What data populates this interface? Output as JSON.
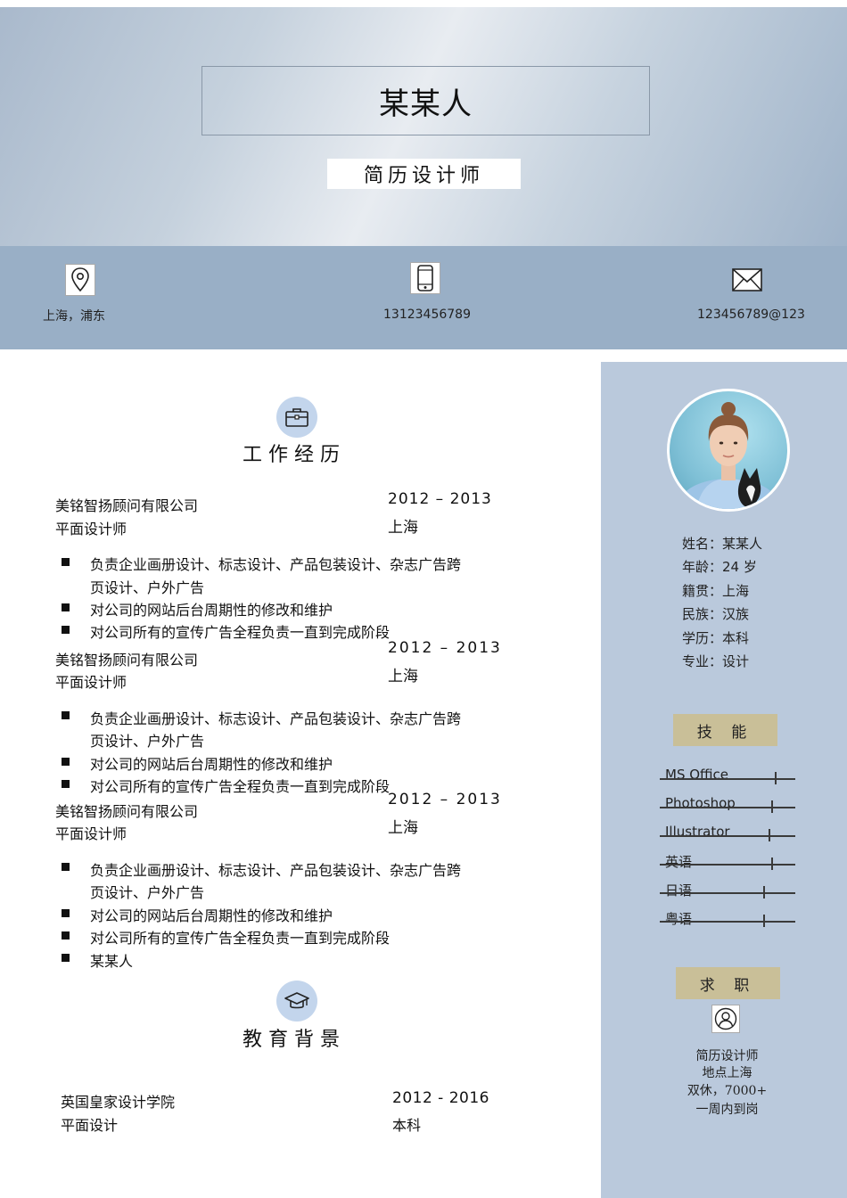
{
  "header": {
    "name": "某某人",
    "title": "简历设计师"
  },
  "contact": [
    {
      "icon": "location-pin-icon",
      "text": "上海，浦东"
    },
    {
      "icon": "mobile-phone-icon",
      "text": "13123456789"
    },
    {
      "icon": "envelope-icon",
      "text": "123456789@123"
    }
  ],
  "work": {
    "title": "工作经历",
    "icon": "briefcase-icon",
    "entries": [
      {
        "company": "美铭智扬顾问有限公司",
        "role": "平面设计师",
        "date": "2012 – 2013",
        "location": "上海",
        "bullets": [
          "负责企业画册设计、标志设计、产品包装设计、杂志广告跨",
          "页设计、户外广告",
          "对公司的网站后台周期性的修改和维护",
          "对公司所有的宣传广告全程负责一直到完成阶段"
        ]
      },
      {
        "company": "美铭智扬顾问有限公司",
        "role": "平面设计师",
        "date": "2012 – 2013",
        "location": "上海",
        "bullets": [
          "负责企业画册设计、标志设计、产品包装设计、杂志广告跨",
          "页设计、户外广告",
          "对公司的网站后台周期性的修改和维护",
          "对公司所有的宣传广告全程负责一直到完成阶段"
        ]
      },
      {
        "company": "美铭智扬顾问有限公司",
        "role": "平面设计师",
        "date": "2012 – 2013",
        "location": "上海",
        "bullets": [
          "负责企业画册设计、标志设计、产品包装设计、杂志广告跨",
          "页设计、户外广告",
          "对公司的网站后台周期性的修改和维护",
          "对公司所有的宣传广告全程负责一直到完成阶段",
          "某某人"
        ]
      }
    ]
  },
  "education": {
    "title": "教育背景",
    "icon": "graduation-cap-icon",
    "school": "英国皇家设计学院",
    "major": "平面设计",
    "date": "2012 - 2016",
    "degree": "本科"
  },
  "profile": {
    "lines": [
      "姓名：某某人",
      "年龄：24 岁",
      "籍贯：上海",
      "民族：汉族",
      "学历：本科",
      "专业：设计"
    ]
  },
  "skills": {
    "title": "技 能",
    "items": [
      {
        "name": "MS Office",
        "level": 0.85
      },
      {
        "name": "Photoshop",
        "level": 0.82
      },
      {
        "name": "Illustrator",
        "level": 0.8
      },
      {
        "name": "英语",
        "level": 0.82
      },
      {
        "name": "日语",
        "level": 0.76
      },
      {
        "name": "粤语",
        "level": 0.76
      }
    ]
  },
  "job": {
    "title": "求 职",
    "icon": "person-icon",
    "lines": [
      "简历设计师",
      "地点上海",
      "双休，7000+",
      "一周内到岗"
    ]
  },
  "colors": {
    "contact_band": "#99afc6",
    "sidebar": "#bac9dc",
    "heading_tag": "#c9bf98",
    "section_icon_bg": "#c3d5ec"
  }
}
